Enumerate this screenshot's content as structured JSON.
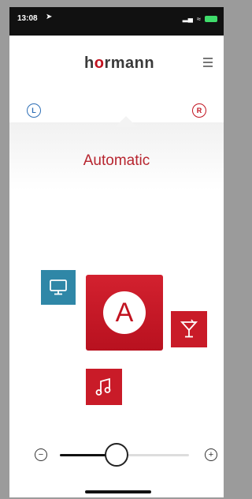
{
  "status": {
    "time": "13:08",
    "location_glyph": "➤",
    "signal": "▂▄",
    "wifi": "≈",
    "battery_color": "#3fdc6b"
  },
  "header": {
    "logo_part1": "h",
    "logo_o": "o",
    "logo_part2": "rmann"
  },
  "zones": {
    "left": "L",
    "right": "R"
  },
  "mode": {
    "title": "Automatic",
    "auto_letter": "A"
  },
  "icons": {
    "tv": "monitor-icon",
    "cocktail": "cocktail-icon",
    "music": "music-note-icon"
  },
  "slider": {
    "minus": "−",
    "plus": "+",
    "level": 0.44
  },
  "colors": {
    "accent": "#c1121f",
    "tv_tile": "#2f87a7"
  }
}
